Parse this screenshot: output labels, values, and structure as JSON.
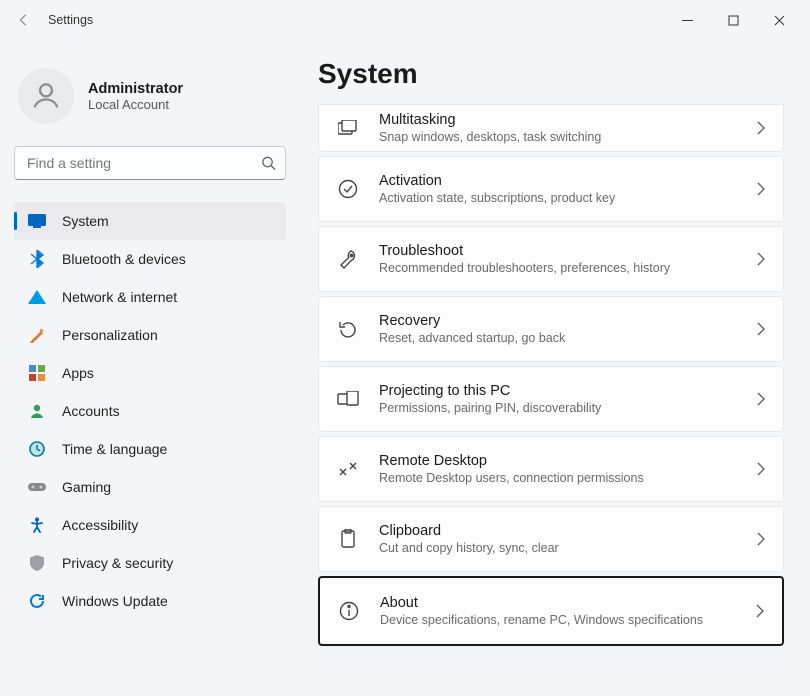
{
  "window": {
    "title": "Settings"
  },
  "user": {
    "name": "Administrator",
    "account_type": "Local Account"
  },
  "search": {
    "placeholder": "Find a setting"
  },
  "nav": [
    {
      "id": "system",
      "label": "System",
      "selected": true
    },
    {
      "id": "bluetooth",
      "label": "Bluetooth & devices"
    },
    {
      "id": "network",
      "label": "Network & internet"
    },
    {
      "id": "personalization",
      "label": "Personalization"
    },
    {
      "id": "apps",
      "label": "Apps"
    },
    {
      "id": "accounts",
      "label": "Accounts"
    },
    {
      "id": "time",
      "label": "Time & language"
    },
    {
      "id": "gaming",
      "label": "Gaming"
    },
    {
      "id": "accessibility",
      "label": "Accessibility"
    },
    {
      "id": "privacy",
      "label": "Privacy & security"
    },
    {
      "id": "update",
      "label": "Windows Update"
    }
  ],
  "page": {
    "heading": "System",
    "cards": [
      {
        "id": "multitasking",
        "title": "Multitasking",
        "sub": "Snap windows, desktops, task switching"
      },
      {
        "id": "activation",
        "title": "Activation",
        "sub": "Activation state, subscriptions, product key"
      },
      {
        "id": "troubleshoot",
        "title": "Troubleshoot",
        "sub": "Recommended troubleshooters, preferences, history"
      },
      {
        "id": "recovery",
        "title": "Recovery",
        "sub": "Reset, advanced startup, go back"
      },
      {
        "id": "projecting",
        "title": "Projecting to this PC",
        "sub": "Permissions, pairing PIN, discoverability"
      },
      {
        "id": "remote",
        "title": "Remote Desktop",
        "sub": "Remote Desktop users, connection permissions"
      },
      {
        "id": "clipboard",
        "title": "Clipboard",
        "sub": "Cut and copy history, sync, clear"
      },
      {
        "id": "about",
        "title": "About",
        "sub": "Device specifications, rename PC, Windows specifications"
      }
    ]
  }
}
